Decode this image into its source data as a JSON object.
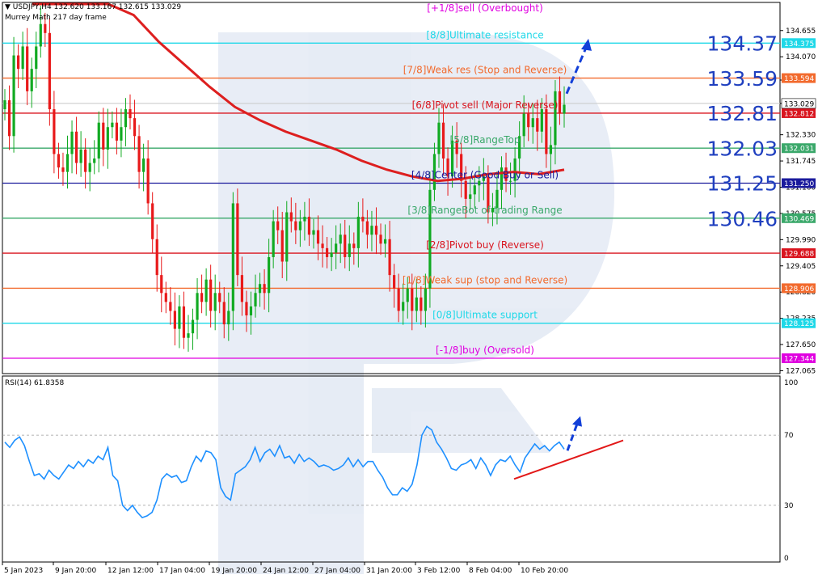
{
  "header": {
    "symbol_line": "USDJPY,H4  132.620 133.167 132.615 133.029",
    "indicator": "Murrey Math 217 day frame"
  },
  "rsi_header": "RSI(14) 61.8358",
  "colors": {
    "bull": "#11aa22",
    "bear": "#e8191a",
    "ma": "#dd1f1f",
    "rsi": "#1e90ff",
    "trend": "#e21818",
    "arrow": "#1340d8",
    "big_label": "#1f3fbf"
  },
  "chart_data": [
    {
      "type": "line",
      "title": "USDJPY,H4",
      "ylim": [
        127.0,
        135.0
      ],
      "y_ticks": [
        "134.655",
        "134.070",
        "133.550",
        "133.029",
        "132.330",
        "131.745",
        "131.160",
        "130.575",
        "129.990",
        "129.405",
        "128.820",
        "128.235",
        "127.650",
        "127.065"
      ],
      "x_labels": [
        "5 Jan 2023",
        "9 Jan 20:00",
        "12 Jan 12:00",
        "17 Jan 04:00",
        "19 Jan 20:00",
        "24 Jan 12:00",
        "27 Jan 04:00",
        "31 Jan 20:00",
        "3 Feb 12:00",
        "8 Feb 04:00",
        "10 Feb 20:00"
      ],
      "murrey_levels": [
        {
          "label": "[+1/8]sell (Overbought)",
          "value": 135.156,
          "tag": "",
          "color": "#e000e0"
        },
        {
          "label": "[8/8]Ultimate resistance",
          "value": 134.375,
          "tag": "134.375",
          "color": "#1ed8e8"
        },
        {
          "label": "[7/8]Weak res (Stop and Reverse)",
          "value": 133.594,
          "tag": "133.594",
          "color": "#f26a2d"
        },
        {
          "label": "[6/8]Pivot sell (Major Reverse)",
          "value": 132.812,
          "tag": "132.812",
          "color": "#d9141e"
        },
        {
          "label": "[5/8]RangeTop",
          "value": 132.031,
          "tag": "132.031",
          "color": "#3aa86a"
        },
        {
          "label": "[4/8]Center (Good Buy or Sell)",
          "value": 131.25,
          "tag": "131.250",
          "color": "#1a1a9c"
        },
        {
          "label": "[3/8]RangeBot of trading Range",
          "value": 130.469,
          "tag": "130.469",
          "color": "#3aa86a"
        },
        {
          "label": "[2/8]Pivot buy (Reverse)",
          "value": 129.688,
          "tag": "129.688",
          "color": "#d9141e"
        },
        {
          "label": "[1/8]Weak sup (stop and Reverse)",
          "value": 128.906,
          "tag": "128.906",
          "color": "#f26a2d"
        },
        {
          "label": "[0/8]Ultimate support",
          "value": 128.125,
          "tag": "128.125",
          "color": "#1ed8e8"
        },
        {
          "label": "[-1/8]buy (Oversold)",
          "value": 127.344,
          "tag": "127.344",
          "color": "#e000e0"
        }
      ],
      "last_price": 133.029,
      "big_labels": [
        "134.37",
        "133.59",
        "132.81",
        "132.03",
        "131.25",
        "130.46"
      ],
      "price_series": [
        133.1,
        132.3,
        134.1,
        133.8,
        134.3,
        133.3,
        133.8,
        134.3,
        134.8,
        134.6,
        132.9,
        131.9,
        131.6,
        131.5,
        131.9,
        132.4,
        131.7,
        132.0,
        131.5,
        131.7,
        131.8,
        132.6,
        132.0,
        132.5,
        132.6,
        132.2,
        132.5,
        132.9,
        132.7,
        132.3,
        131.5,
        131.8,
        130.8,
        130.0,
        129.2,
        128.8,
        128.6,
        128.4,
        128.0,
        128.5,
        127.8,
        127.9,
        128.2,
        128.8,
        128.6,
        129.1,
        128.4,
        128.8,
        128.6,
        128.1,
        128.4,
        130.8,
        129.2,
        128.6,
        128.3,
        128.5,
        128.8,
        129.0,
        128.8,
        129.6,
        130.4,
        130.2,
        129.5,
        130.6,
        130.4,
        130.2,
        130.4,
        130.5,
        130.1,
        130.2,
        129.9,
        129.8,
        129.6,
        129.7,
        129.9,
        130.1,
        129.6,
        129.9,
        129.8,
        130.5,
        130.4,
        130.1,
        130.3,
        130.1,
        129.9,
        130.0,
        129.2,
        128.9,
        128.4,
        128.6,
        128.9,
        128.4,
        128.7,
        128.4,
        128.9,
        131.1,
        131.9,
        132.6,
        131.8,
        131.4,
        132.2,
        131.9,
        131.3,
        130.9,
        131.0,
        131.2,
        131.3,
        131.4,
        130.6,
        130.7,
        131.1,
        131.6,
        131.3,
        131.3,
        131.8,
        132.3,
        132.8,
        132.5,
        132.7,
        132.4,
        132.9,
        131.9,
        132.1,
        133.3,
        132.8,
        133.0
      ],
      "ma_series": [
        139.5,
        138.5,
        137.2,
        136.0,
        135.0,
        134.4,
        133.9,
        133.4,
        132.95,
        132.65,
        132.4,
        132.2,
        132.0,
        131.75,
        131.55,
        131.4,
        131.3,
        131.35,
        131.45,
        131.5,
        131.45,
        131.55
      ],
      "arrow": {
        "from": [
          133.0,
          133.5
        ],
        "to_price": 134.4
      }
    },
    {
      "type": "line",
      "title": "RSI(14) 61.8358",
      "ylim": [
        0,
        100
      ],
      "y_ticks": [
        "100",
        "70",
        "30",
        "0"
      ],
      "levels": [
        70,
        30
      ],
      "rsi_series": [
        66,
        63,
        67,
        69,
        64,
        55,
        47,
        48,
        45,
        50,
        47,
        45,
        49,
        53,
        51,
        55,
        52,
        56,
        54,
        58,
        56,
        63,
        47,
        44,
        30,
        27,
        30,
        26,
        23,
        24,
        26,
        33,
        45,
        48,
        46,
        47,
        43,
        44,
        52,
        58,
        55,
        61,
        60,
        56,
        40,
        35,
        33,
        48,
        50,
        52,
        56,
        63,
        55,
        60,
        62,
        58,
        64,
        57,
        58,
        54,
        59,
        55,
        57,
        55,
        52,
        53,
        52,
        50,
        51,
        53,
        57,
        52,
        56,
        52,
        55,
        55,
        50,
        46,
        40,
        36,
        36,
        40,
        38,
        42,
        53,
        70,
        75,
        73,
        66,
        62,
        57,
        51,
        50,
        53,
        54,
        56,
        51,
        57,
        53,
        47,
        53,
        56,
        55,
        58,
        53,
        49,
        57,
        61,
        65,
        62,
        64,
        61,
        64,
        66,
        62
      ],
      "trendline": {
        "from": [
          45,
          28
        ],
        "to": [
          71,
          45
        ]
      }
    }
  ]
}
